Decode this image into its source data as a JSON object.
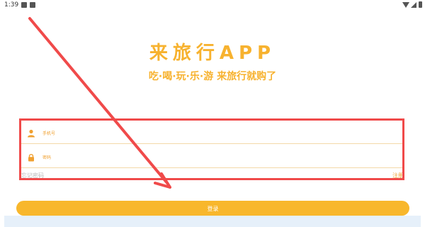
{
  "status_bar": {
    "time": "1:39"
  },
  "header": {
    "app_title": "来旅行APP",
    "slogan": "吃·喝·玩·乐·游 来旅行就购了"
  },
  "form": {
    "phone_placeholder": "手机号",
    "password_placeholder": "密码",
    "remember_label": "忘记密码",
    "register_label": "注册"
  },
  "login": {
    "button_label": "登录"
  },
  "colors": {
    "accent": "#f7b22f",
    "annotation": "#f04a4a",
    "button": "#f8b72c"
  },
  "icons": [
    "image-icon",
    "notification-icon",
    "wifi-icon",
    "signal-icon",
    "battery-icon",
    "user-icon",
    "lock-icon"
  ]
}
